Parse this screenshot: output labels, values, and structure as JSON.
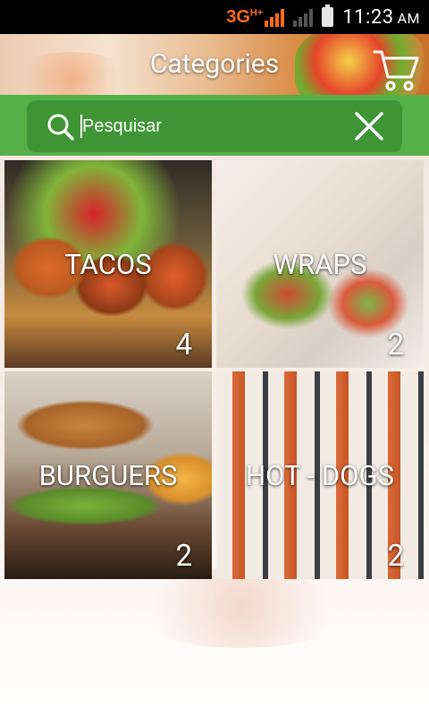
{
  "status_bar": {
    "network": "3G",
    "network_sup": "H+",
    "time": "11:23",
    "ampm": "AM",
    "accent_color": "#ff6a1a"
  },
  "header": {
    "title": "Categories",
    "cart_icon": "shopping-cart-icon"
  },
  "search": {
    "placeholder": "Pesquisar",
    "value": "",
    "search_icon": "search-icon",
    "clear_icon": "close-icon",
    "bar_color": "#55b047",
    "box_color": "#3f9535"
  },
  "categories": [
    {
      "name": "TACOS",
      "count": "4"
    },
    {
      "name": "WRAPS",
      "count": "2"
    },
    {
      "name": "BURGUERS",
      "count": "2"
    },
    {
      "name": "HOT - DOGS",
      "count": "2"
    }
  ]
}
